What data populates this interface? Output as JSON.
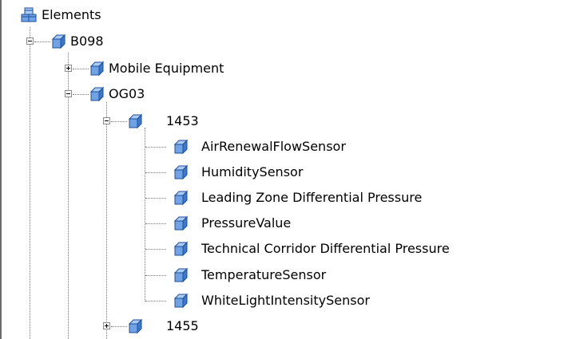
{
  "tree": {
    "root": {
      "label": "Elements",
      "icon": "package-icon"
    },
    "b098": {
      "label": "B098",
      "icon": "cube-icon",
      "expanded": true
    },
    "mobile_equipment": {
      "label": "Mobile Equipment",
      "icon": "cube-icon",
      "expanded": false
    },
    "og03": {
      "label": "OG03",
      "icon": "cube-icon",
      "expanded": true
    },
    "n1453": {
      "label": "1453",
      "icon": "cube-icon",
      "expanded": true
    },
    "sensors": [
      {
        "label": "AirRenewalFlowSensor",
        "icon": "cube-icon"
      },
      {
        "label": "HumiditySensor",
        "icon": "cube-icon"
      },
      {
        "label": "Leading Zone Differential Pressure",
        "icon": "cube-icon"
      },
      {
        "label": "PressureValue",
        "icon": "cube-icon"
      },
      {
        "label": "Technical Corridor Differential Pressure",
        "icon": "cube-icon"
      },
      {
        "label": "TemperatureSensor",
        "icon": "cube-icon"
      },
      {
        "label": "WhiteLightIntensitySensor",
        "icon": "cube-icon"
      }
    ],
    "n1455": {
      "label": "1455",
      "icon": "cube-icon",
      "expanded": false
    }
  },
  "colors": {
    "cube_face": "#6fa3e6",
    "cube_top": "#a9ccf5",
    "cube_side": "#3f78c9",
    "cube_outline": "#1f4f9c",
    "connector": "#7a7a7a",
    "left_border": "#6b6b6b"
  }
}
